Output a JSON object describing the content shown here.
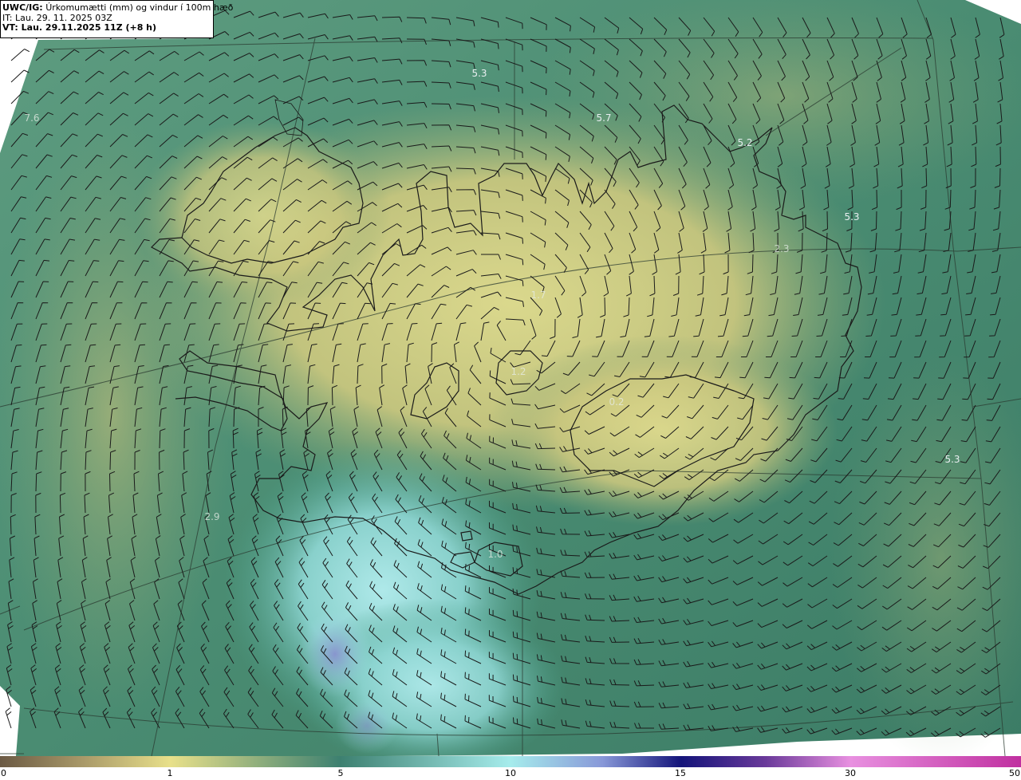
{
  "header": {
    "model": "UWC/IG:",
    "title_text": "Úrkomumætti (mm) og vindur í 100m hæð",
    "it_line": "IT: Lau. 29. 11. 2025 03Z",
    "vt_line": "VT: Lau. 29.11.2025 11Z (+8 h)"
  },
  "map": {
    "region": "Iceland",
    "colors": {
      "dry": "#8a7a5c",
      "low": "#e6e08a",
      "mid": "#5c9a78",
      "high": "#a8e6e6",
      "heavy": "#7a86c8",
      "coast": "#1a1a1a",
      "barb": "#1a1a1a"
    },
    "value_labels": [
      {
        "text": "5.3",
        "faint": false
      },
      {
        "text": "5.7",
        "faint": false
      },
      {
        "text": "5.2",
        "faint": false
      },
      {
        "text": "5.3",
        "faint": false
      },
      {
        "text": "2.3",
        "faint": true
      },
      {
        "text": "5.3",
        "faint": false
      },
      {
        "text": "2.9",
        "faint": true
      },
      {
        "text": "1.0",
        "faint": true
      },
      {
        "text": "1.2",
        "faint": true
      },
      {
        "text": "0.2",
        "faint": true
      },
      {
        "text": "7.6",
        "faint": true
      },
      {
        "text": "1.7",
        "faint": true
      }
    ]
  },
  "colorbar": {
    "ticks": [
      "0",
      "1",
      "5",
      "10",
      "15",
      "30",
      "50"
    ],
    "colors": [
      "#6b5a44",
      "#c8b87a",
      "#e8e08a",
      "#3d8070",
      "#a6ecec",
      "#2a3aa0",
      "#14147a",
      "#c878c8",
      "#c030a0"
    ]
  }
}
